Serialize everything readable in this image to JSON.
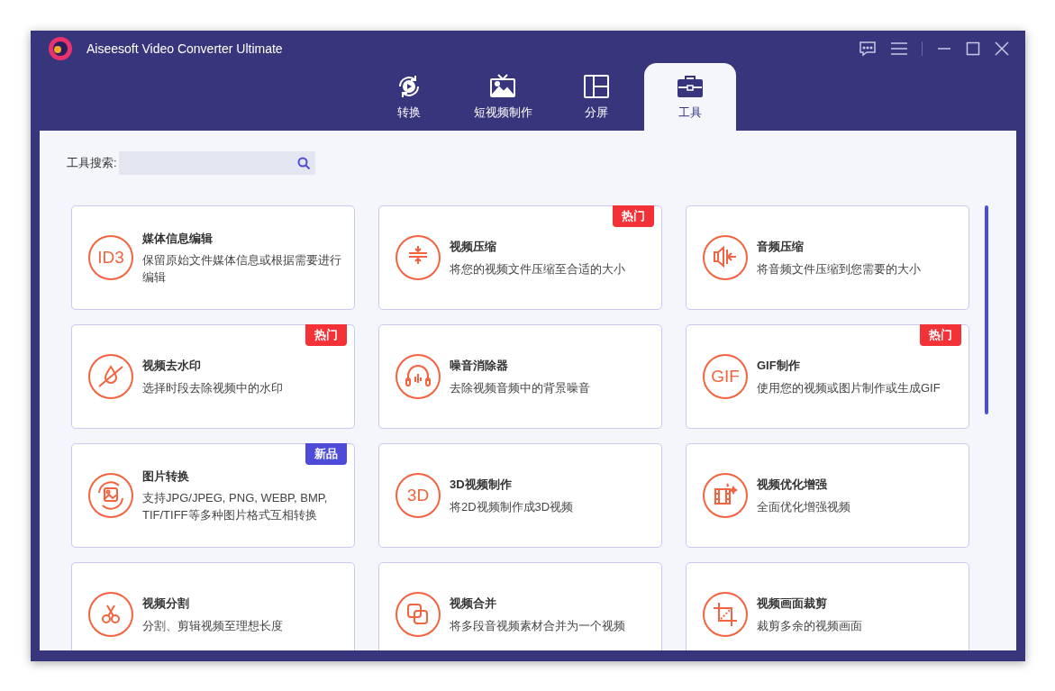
{
  "window": {
    "title": "Aiseesoft Video Converter Ultimate"
  },
  "tabs": [
    {
      "label": "转换",
      "selected": false
    },
    {
      "label": "短视频制作",
      "selected": false
    },
    {
      "label": "分屏",
      "selected": false
    },
    {
      "label": "工具",
      "selected": true
    }
  ],
  "search": {
    "label": "工具搜索:"
  },
  "tools": [
    {
      "title": "媒体信息编辑",
      "description": "保留原始文件媒体信息或根据需要进行编辑",
      "icon_text": "ID3"
    },
    {
      "title": "视频压缩",
      "description": "将您的视频文件压缩至合适的大小",
      "badge": {
        "text": "热门",
        "color": "#f23237"
      }
    },
    {
      "title": "音频压缩",
      "description": "将音频文件压缩到您需要的大小"
    },
    {
      "title": "视频去水印",
      "description": "选择时段去除视频中的水印",
      "badge": {
        "text": "热门",
        "color": "#f23237"
      }
    },
    {
      "title": "噪音消除器",
      "description": "去除视频音频中的背景噪音"
    },
    {
      "title": "GIF制作",
      "description": "使用您的视频或图片制作或生成GIF",
      "icon_text": "GIF",
      "badge": {
        "text": "热门",
        "color": "#f23237"
      }
    },
    {
      "title": "图片转换",
      "description": "支持JPG/JPEG, PNG, WEBP, BMP, TIF/TIFF等多种图片格式互相转换",
      "badge": {
        "text": "新品",
        "color": "#4f4bd9"
      }
    },
    {
      "title": "3D视频制作",
      "description": "将2D视频制作成3D视频",
      "icon_text": "3D"
    },
    {
      "title": "视频优化增强",
      "description": "全面优化增强视频"
    },
    {
      "title": "视频分割",
      "description": "分割、剪辑视频至理想长度"
    },
    {
      "title": "视频合并",
      "description": "将多段音视频素材合并为一个视频"
    },
    {
      "title": "视频画面裁剪",
      "description": "裁剪多余的视频画面"
    }
  ]
}
